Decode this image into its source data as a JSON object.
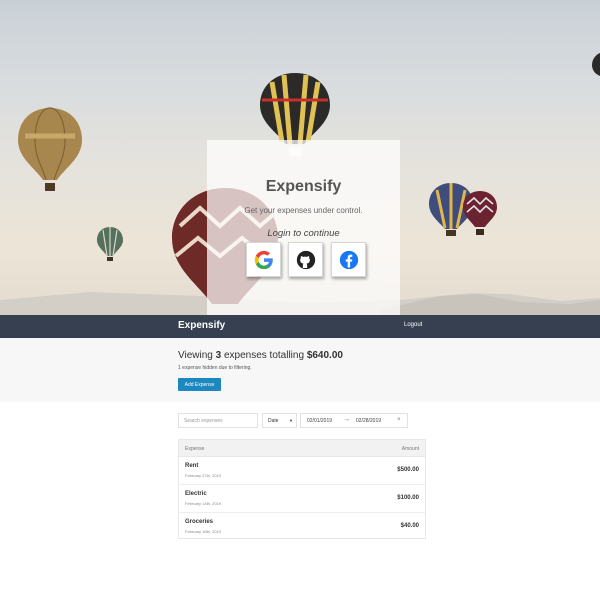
{
  "login": {
    "title": "Expensify",
    "tagline": "Get your expenses under control.",
    "prompt": "Login to continue",
    "providers": [
      {
        "name": "google",
        "icon": "google-icon"
      },
      {
        "name": "github",
        "icon": "github-icon"
      },
      {
        "name": "facebook",
        "icon": "facebook-icon"
      }
    ]
  },
  "header": {
    "brand": "Expensify",
    "logout_label": "Logout",
    "background": "#364051"
  },
  "summary": {
    "prefix": "Viewing ",
    "count": "3",
    "middle": " expenses totalling ",
    "total": "$640.00",
    "hidden_note": "1 expense hidden due to filtering.",
    "add_button_label": "Add Expense",
    "accent": "#1c88bf"
  },
  "filters": {
    "search_placeholder": "Search expenses",
    "sort_selected": "Date",
    "start_date": "02/01/2019",
    "end_date": "02/28/2019",
    "arrow_icon": "arrow-right-icon",
    "clear_icon": "close-icon"
  },
  "expenses": {
    "header_left": "Expense",
    "header_right": "Amount",
    "rows": [
      {
        "description": "Rent",
        "date": "February 27th, 2019",
        "amount": "$500.00"
      },
      {
        "description": "Electric",
        "date": "February 14th, 2019",
        "amount": "$100.00"
      },
      {
        "description": "Groceries",
        "date": "February 18th, 2019",
        "amount": "$40.00"
      }
    ]
  }
}
